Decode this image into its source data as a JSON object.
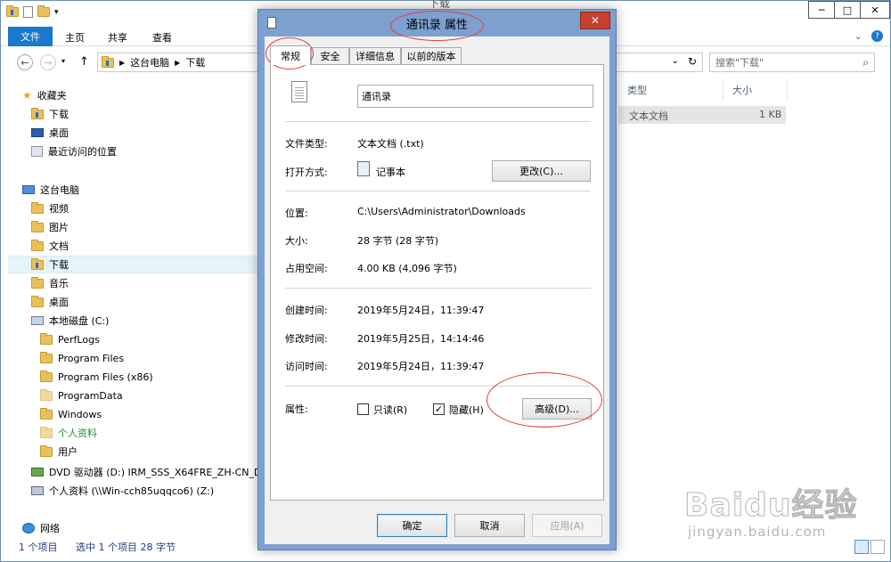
{
  "explorer": {
    "title": "下载",
    "ribbon_tabs": [
      "文件",
      "主页",
      "共享",
      "查看"
    ],
    "address": [
      "这台电脑",
      "下载"
    ],
    "search_placeholder": "搜索\"下载\"",
    "nav": {
      "favorites": "收藏夹",
      "fav_items": [
        "下载",
        "桌面",
        "最近访问的位置"
      ],
      "this_pc": "这台电脑",
      "pc_items": [
        "视频",
        "图片",
        "文档",
        "下载",
        "音乐",
        "桌面"
      ],
      "local_disk": "本地磁盘 (C:)",
      "disk_items": [
        "PerfLogs",
        "Program Files",
        "Program Files (x86)",
        "ProgramData",
        "Windows",
        "个人资料",
        "用户"
      ],
      "dvd": "DVD 驱动器 (D:) IRM_SSS_X64FRE_ZH-CN_DV",
      "network_drive": "个人资料 (\\\\Win-cch85uqqco6) (Z:)",
      "network": "网络"
    },
    "columns": [
      "类型",
      "大小"
    ],
    "file_row": {
      "type": "文本文档",
      "size": "1 KB"
    },
    "status": {
      "count": "1 个项目",
      "selected": "选中 1 个项目  28 字节"
    }
  },
  "dialog": {
    "title": "通讯录 属性",
    "tabs": [
      "常规",
      "安全",
      "详细信息",
      "以前的版本"
    ],
    "filename": "通讯录",
    "file_type_label": "文件类型:",
    "file_type": "文本文档 (.txt)",
    "open_with_label": "打开方式:",
    "open_with": "记事本",
    "change_button": "更改(C)...",
    "location_label": "位置:",
    "location": "C:\\Users\\Administrator\\Downloads",
    "size_label": "大小:",
    "size": "28 字节 (28 字节)",
    "disk_size_label": "占用空间:",
    "disk_size": "4.00 KB (4,096 字节)",
    "created_label": "创建时间:",
    "created": "2019年5月24日，11:39:47",
    "modified_label": "修改时间:",
    "modified": "2019年5月25日，14:14:46",
    "accessed_label": "访问时间:",
    "accessed": "2019年5月24日，11:39:47",
    "attributes_label": "属性:",
    "readonly_label": "只读(R)",
    "readonly_checked": false,
    "hidden_label": "隐藏(H)",
    "hidden_checked": true,
    "advanced_button": "高级(D)...",
    "ok_button": "确定",
    "cancel_button": "取消",
    "apply_button": "应用(A)"
  },
  "watermark": {
    "brand": "Baidu经验",
    "url": "jingyan.baidu.com"
  },
  "colors": {
    "accent": "#1979ca",
    "annotation": "#e53935",
    "dialog_frame": "#7da0d0"
  }
}
